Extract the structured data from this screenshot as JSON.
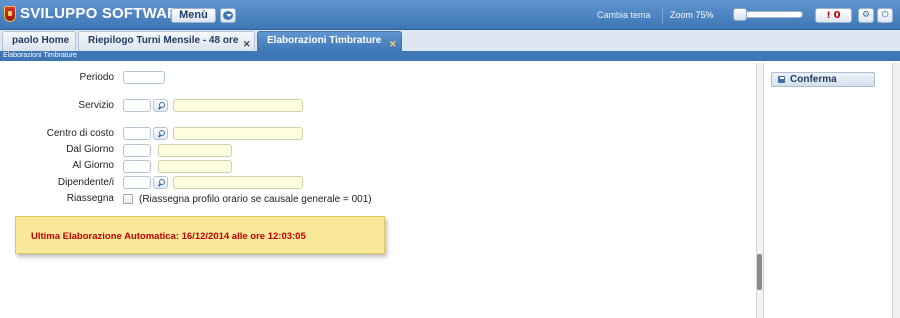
{
  "header": {
    "app_title": "SVILUPPO SOFTWARE",
    "menu_label": "Menù",
    "theme_label": "Cambia tema",
    "zoom_label": "Zoom 75%",
    "zoom_percent": 75,
    "alert_count": "0",
    "alert_mark": "!",
    "brand_color": "#3e76b6"
  },
  "tabs": [
    {
      "label": "paolo Home",
      "closable": false
    },
    {
      "label": "Riepilogo Turni Mensile - 48 ore",
      "closable": true
    },
    {
      "label": "Elaborazioni Timbrature",
      "closable": true,
      "active": true
    }
  ],
  "close_glyph": "✕",
  "breadcrumb": "Elaborazioni Timbrature",
  "form": {
    "periodo": "Periodo",
    "servizio": "Servizio",
    "centro_costo": "Centro di costo",
    "dal_giorno": "Dal Giorno",
    "al_giorno": "Al Giorno",
    "dipendente": "Dipendente/i",
    "riassegna": "Riassegna",
    "riassegna_note": "(Riassegna profilo orario se causale generale = 001)"
  },
  "banner": {
    "text": "Ultima Elaborazione Automatica: 16/12/2014 alle ore 12:03:05",
    "color": "#c00000"
  },
  "actions": {
    "confirm_label": "Conferma"
  },
  "icons": {
    "logo": "crest-icon",
    "menu_dropdown": "chevron-down-icon",
    "settings": "gear-icon",
    "power": "power-icon",
    "lookup": "search-icon",
    "save": "save-icon"
  }
}
